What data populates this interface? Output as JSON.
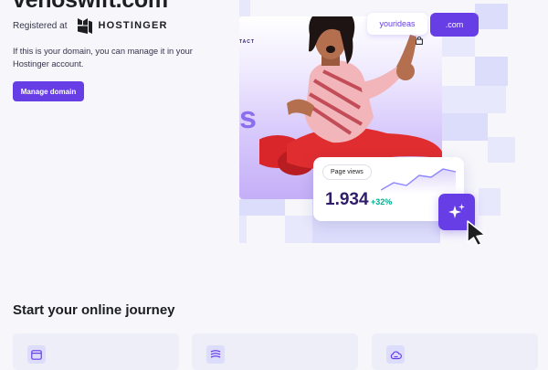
{
  "domain": "venoswift.com",
  "registrar": {
    "label": "Registered at",
    "name": "HOSTINGER",
    "logo_icon": "hostinger-logo-icon"
  },
  "manage": {
    "text": "If this is your domain, you can manage it in your Hostinger account.",
    "button_label": "Manage domain"
  },
  "hero": {
    "nav_text": "TACT",
    "big_letter": "s",
    "domain_pill": "yourideas",
    "tld_pill": ".com",
    "stats": {
      "label": "Page views",
      "value": "1.934",
      "delta": "+32%"
    },
    "icons": [
      "shopping-bag-icon",
      "sparkles-icon",
      "cursor-icon"
    ]
  },
  "journey": {
    "title": "Start your online journey",
    "cards": [
      {
        "icon": "browser-window-icon"
      },
      {
        "icon": "layers-icon"
      },
      {
        "icon": "cloud-hosting-icon"
      }
    ]
  },
  "colors": {
    "accent": "#673de6",
    "tile": "#dcdcfb",
    "background": "#f6f6fb",
    "positive": "#00b090"
  }
}
